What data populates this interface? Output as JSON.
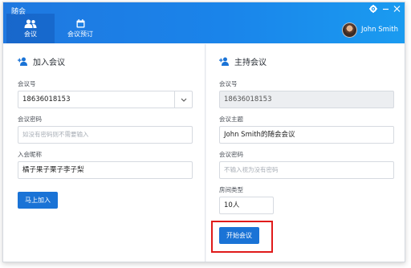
{
  "window": {
    "title": "随会"
  },
  "header": {
    "tabs": [
      {
        "label": "会议",
        "icon": "people-icon",
        "active": true
      },
      {
        "label": "会议预订",
        "icon": "calendar-icon",
        "active": false
      }
    ],
    "user_name": "John Smith"
  },
  "join": {
    "title": "加入会议",
    "meeting_id_label": "会议号",
    "meeting_id_value": "18636018153",
    "password_label": "会议密码",
    "password_placeholder": "如没有密码则不需要输入",
    "nickname_label": "入会昵称",
    "nickname_value": "橘子果子栗子李子梨",
    "join_button": "马上加入"
  },
  "host": {
    "title": "主持会议",
    "meeting_id_label": "会议号",
    "meeting_id_value": "18636018153",
    "topic_label": "会议主题",
    "topic_value": "John Smith的随会会议",
    "password_label": "会议密码",
    "password_placeholder": "不输入视为没有密码",
    "room_type_label": "房间类型",
    "room_type_value": "10人",
    "start_button": "开始会议"
  },
  "colors": {
    "accent": "#1a73d6",
    "highlight": "#e01b1b"
  }
}
